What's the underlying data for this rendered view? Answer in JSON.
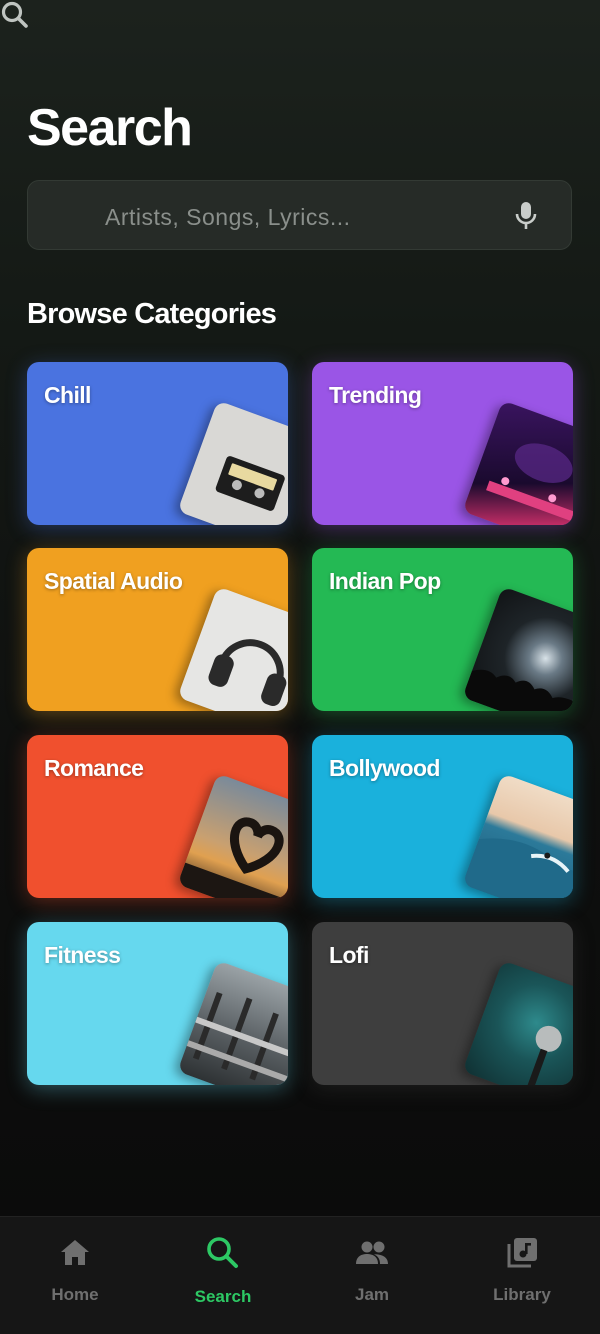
{
  "page": {
    "title": "Search"
  },
  "search": {
    "placeholder": "Artists, Songs, Lyrics..."
  },
  "section": {
    "title": "Browse Categories"
  },
  "categories": [
    {
      "label": "Chill",
      "color": "#4a73e0"
    },
    {
      "label": "Trending",
      "color": "#9a55e6"
    },
    {
      "label": "Spatial Audio",
      "color": "#f0a020"
    },
    {
      "label": "Indian Pop",
      "color": "#24b954"
    },
    {
      "label": "Romance",
      "color": "#f0502e"
    },
    {
      "label": "Bollywood",
      "color": "#1ab1dc"
    },
    {
      "label": "Fitness",
      "color": "#66d8ee"
    },
    {
      "label": "Lofi",
      "color": "#3e3e3e"
    }
  ],
  "nav": {
    "items": [
      {
        "label": "Home",
        "icon": "home-icon"
      },
      {
        "label": "Search",
        "icon": "search-icon",
        "active": true
      },
      {
        "label": "Jam",
        "icon": "people-icon"
      },
      {
        "label": "Library",
        "icon": "library-icon"
      }
    ]
  },
  "colors": {
    "accent": "#2dc864",
    "background": "#111411"
  }
}
